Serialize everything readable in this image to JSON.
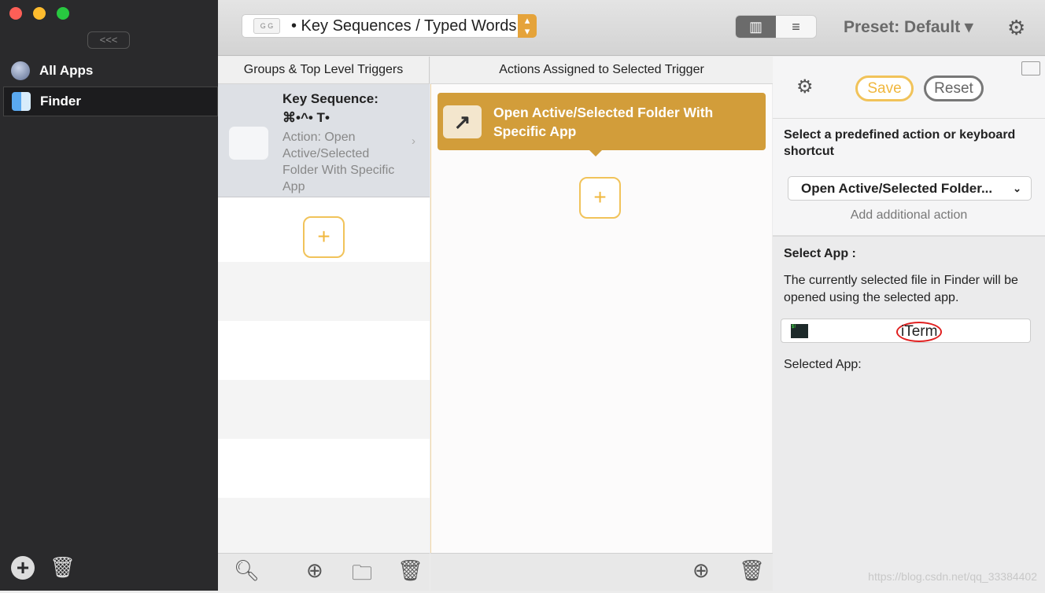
{
  "sidebar": {
    "collapse_label": "<<<",
    "items": [
      {
        "label": "All Apps",
        "icon": "globe-icon"
      },
      {
        "label": "Finder",
        "icon": "finder-icon"
      }
    ],
    "add_icon": "plus-circle-icon",
    "delete_icon": "trash-icon"
  },
  "toolbar": {
    "trigger_type": "• Key Sequences / Typed Words",
    "trigger_icon_text": "G G",
    "preset": "Preset: Default ▾",
    "view_modes": [
      "columns",
      "list"
    ]
  },
  "columns": {
    "triggers_header": "Groups & Top Level Triggers",
    "actions_header": "Actions Assigned to Selected Trigger"
  },
  "trigger": {
    "title": "Key Sequence:",
    "keys": "⌘•^• T•",
    "description": "Action: Open Active/Selected Folder With Specific App"
  },
  "action": {
    "label": "Open Active/Selected Folder With Specific App"
  },
  "right_panel": {
    "save": "Save",
    "reset": "Reset",
    "predefined_heading": "Select a predefined action or keyboard shortcut",
    "selected_action": "Open Active/Selected Folder...",
    "add_additional": "Add additional action",
    "select_app_heading": "Select App :",
    "select_app_desc": "The currently selected file in Finder will be opened using the selected app.",
    "app_name": "iTerm",
    "selected_app_label": "Selected App:"
  },
  "watermark": "https://blog.csdn.net/qq_33384402",
  "colors": {
    "accent": "#d29d3a",
    "save_border": "#f1c35a",
    "sidebar": "#2a2a2c"
  }
}
